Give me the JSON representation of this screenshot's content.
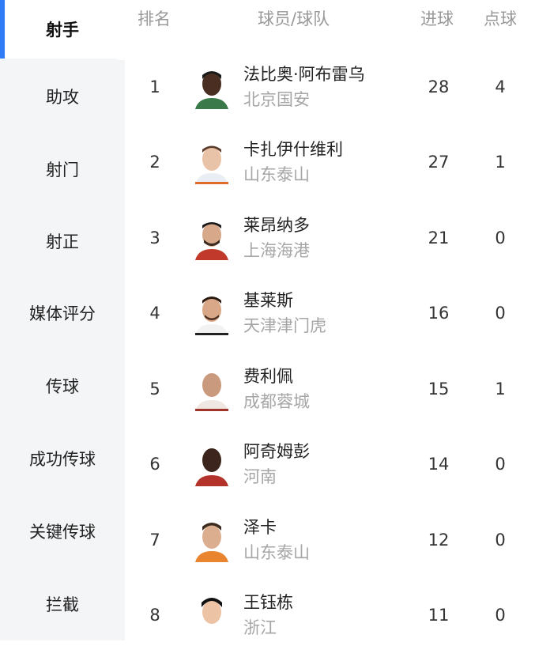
{
  "sidebar": {
    "items": [
      {
        "label": "射手"
      },
      {
        "label": "助攻"
      },
      {
        "label": "射门"
      },
      {
        "label": "射正"
      },
      {
        "label": "媒体评分"
      },
      {
        "label": "传球"
      },
      {
        "label": "成功传球"
      },
      {
        "label": "关键传球"
      },
      {
        "label": "拦截"
      }
    ]
  },
  "table": {
    "headers": {
      "rank": "排名",
      "player_team": "球员/球队",
      "goals": "进球",
      "penalties": "点球"
    },
    "rows": [
      {
        "rank": "1",
        "name": "法比奥·阿布雷乌",
        "team": "北京国安",
        "goals": "28",
        "penalties": "4"
      },
      {
        "rank": "2",
        "name": "卡扎伊什维利",
        "team": "山东泰山",
        "goals": "27",
        "penalties": "1"
      },
      {
        "rank": "3",
        "name": "莱昂纳多",
        "team": "上海海港",
        "goals": "21",
        "penalties": "0"
      },
      {
        "rank": "4",
        "name": "基莱斯",
        "team": "天津津门虎",
        "goals": "16",
        "penalties": "0"
      },
      {
        "rank": "5",
        "name": "费利佩",
        "team": "成都蓉城",
        "goals": "15",
        "penalties": "1"
      },
      {
        "rank": "6",
        "name": "阿奇姆彭",
        "team": "河南",
        "goals": "14",
        "penalties": "0"
      },
      {
        "rank": "7",
        "name": "泽卡",
        "team": "山东泰山",
        "goals": "12",
        "penalties": "0"
      },
      {
        "rank": "8",
        "name": "王钰栋",
        "team": "浙江",
        "goals": "11",
        "penalties": "0"
      }
    ]
  },
  "colors": {
    "accent": "#2f7cf6",
    "sidebar_bg": "#f4f5f7",
    "muted_text": "#a6a6a6"
  }
}
